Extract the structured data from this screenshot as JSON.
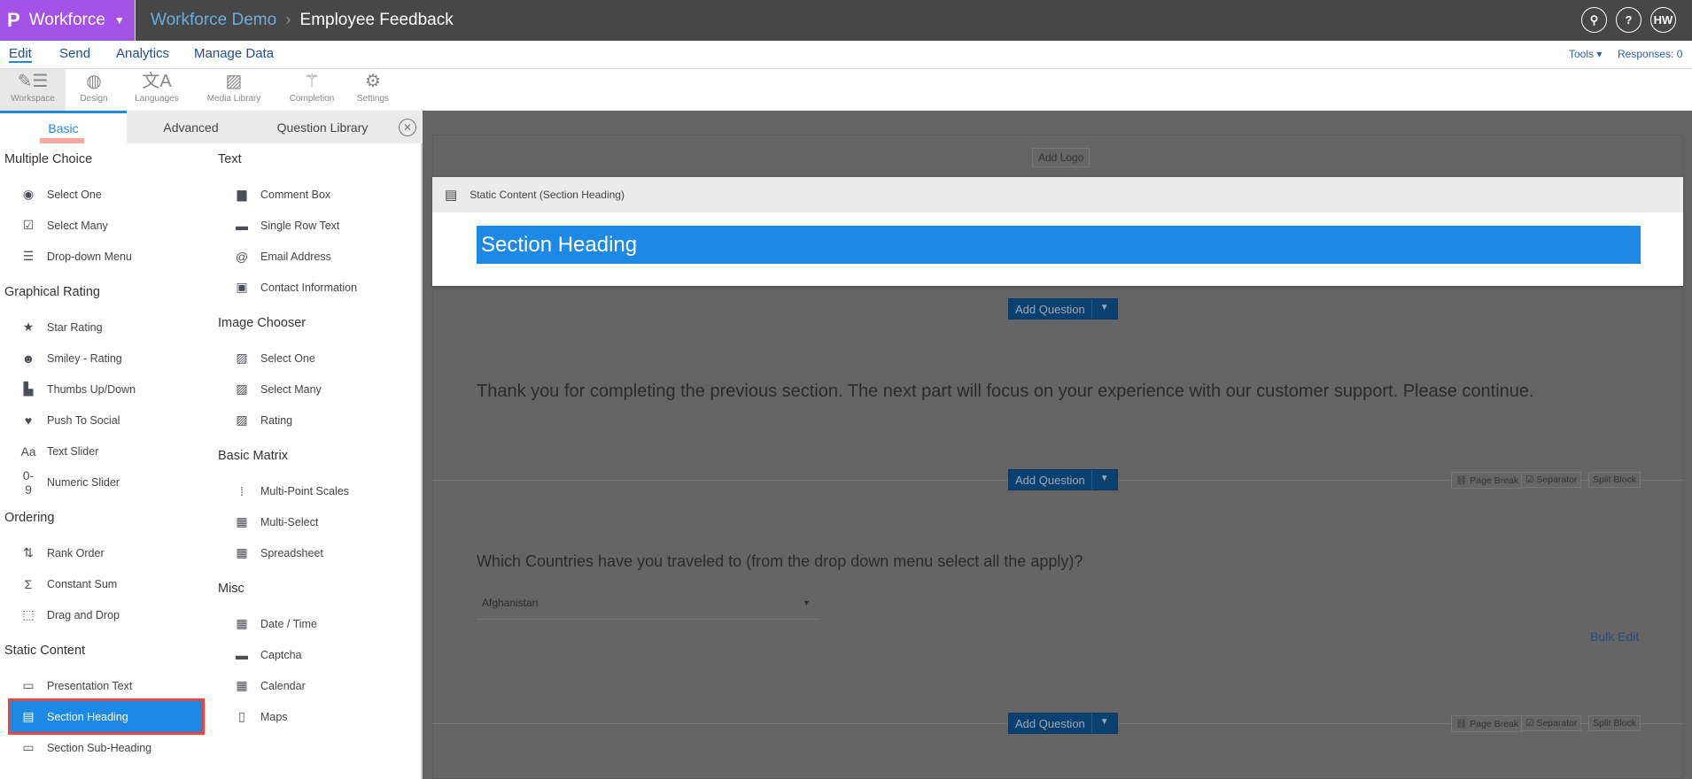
{
  "topbar": {
    "brand": "Workforce",
    "breadcrumb_parent": "Workforce Demo",
    "breadcrumb_current": "Employee Feedback",
    "user_initials": "HW"
  },
  "nav": {
    "items": [
      "Edit",
      "Send",
      "Analytics",
      "Manage Data"
    ],
    "tools": "Tools",
    "responses": "Responses: 0"
  },
  "toolbar": [
    "Workspace",
    "Design",
    "Languages",
    "Media Library",
    "Completion",
    "Settings"
  ],
  "tabs": {
    "basic": "Basic",
    "advanced": "Advanced",
    "library": "Question Library"
  },
  "sidebar": {
    "col1": [
      {
        "title": "Multiple Choice",
        "items": [
          [
            "Select One",
            "◉"
          ],
          [
            "Select Many",
            "☑"
          ],
          [
            "Drop-down Menu",
            "☰"
          ]
        ]
      },
      {
        "title": "Graphical Rating",
        "items": [
          [
            "Star Rating",
            "★"
          ],
          [
            "Smiley - Rating",
            "☻"
          ],
          [
            "Thumbs Up/Down",
            "▙"
          ],
          [
            "Push To Social",
            "♥"
          ],
          [
            "Text Slider",
            "Aa"
          ],
          [
            "Numeric Slider",
            "0-9"
          ]
        ]
      },
      {
        "title": "Ordering",
        "items": [
          [
            "Rank Order",
            "⇅"
          ],
          [
            "Constant Sum",
            "Σ"
          ],
          [
            "Drag and Drop",
            "⬚"
          ]
        ]
      },
      {
        "title": "Static Content",
        "items": [
          [
            "Presentation Text",
            "▭"
          ],
          [
            "Section Heading",
            "▤"
          ],
          [
            "Section Sub-Heading",
            "▭"
          ]
        ]
      }
    ],
    "col2": [
      {
        "title": "Text",
        "items": [
          [
            "Comment Box",
            "▆"
          ],
          [
            "Single Row Text",
            "▬"
          ],
          [
            "Email Address",
            "@"
          ],
          [
            "Contact Information",
            "▣"
          ]
        ]
      },
      {
        "title": "Image Chooser",
        "items": [
          [
            "Select One",
            "▨"
          ],
          [
            "Select Many",
            "▨"
          ],
          [
            "Rating",
            "▨"
          ]
        ]
      },
      {
        "title": "Basic Matrix",
        "items": [
          [
            "Multi-Point Scales",
            "⁞"
          ],
          [
            "Multi-Select",
            "▦"
          ],
          [
            "Spreadsheet",
            "▦"
          ]
        ]
      },
      {
        "title": "Misc",
        "items": [
          [
            "Date / Time",
            "▦"
          ],
          [
            "Captcha",
            "▬"
          ],
          [
            "Calendar",
            "▦"
          ],
          [
            "Maps",
            "▯"
          ]
        ]
      }
    ],
    "selected": "Section Heading"
  },
  "canvas": {
    "add_logo": "Add Logo",
    "block_label": "Static Content (Section Heading)",
    "section_heading": "Section Heading",
    "add_question": "Add Question",
    "presentation_text": "Thank you for completing the previous section. The next part will focus on your experience with our customer support. Please continue.",
    "page_break": "Page Break",
    "separator": "Separator",
    "split_block": "Split Block",
    "question": "Which Countries have you traveled to (from the drop down menu select all the apply)?",
    "dropdown_value": "Afghanistan",
    "bulk_edit": "Bulk Edit"
  },
  "colors": {
    "brand": "#a352e6",
    "accent": "#1e88e5",
    "highlight": "#e8483c"
  }
}
